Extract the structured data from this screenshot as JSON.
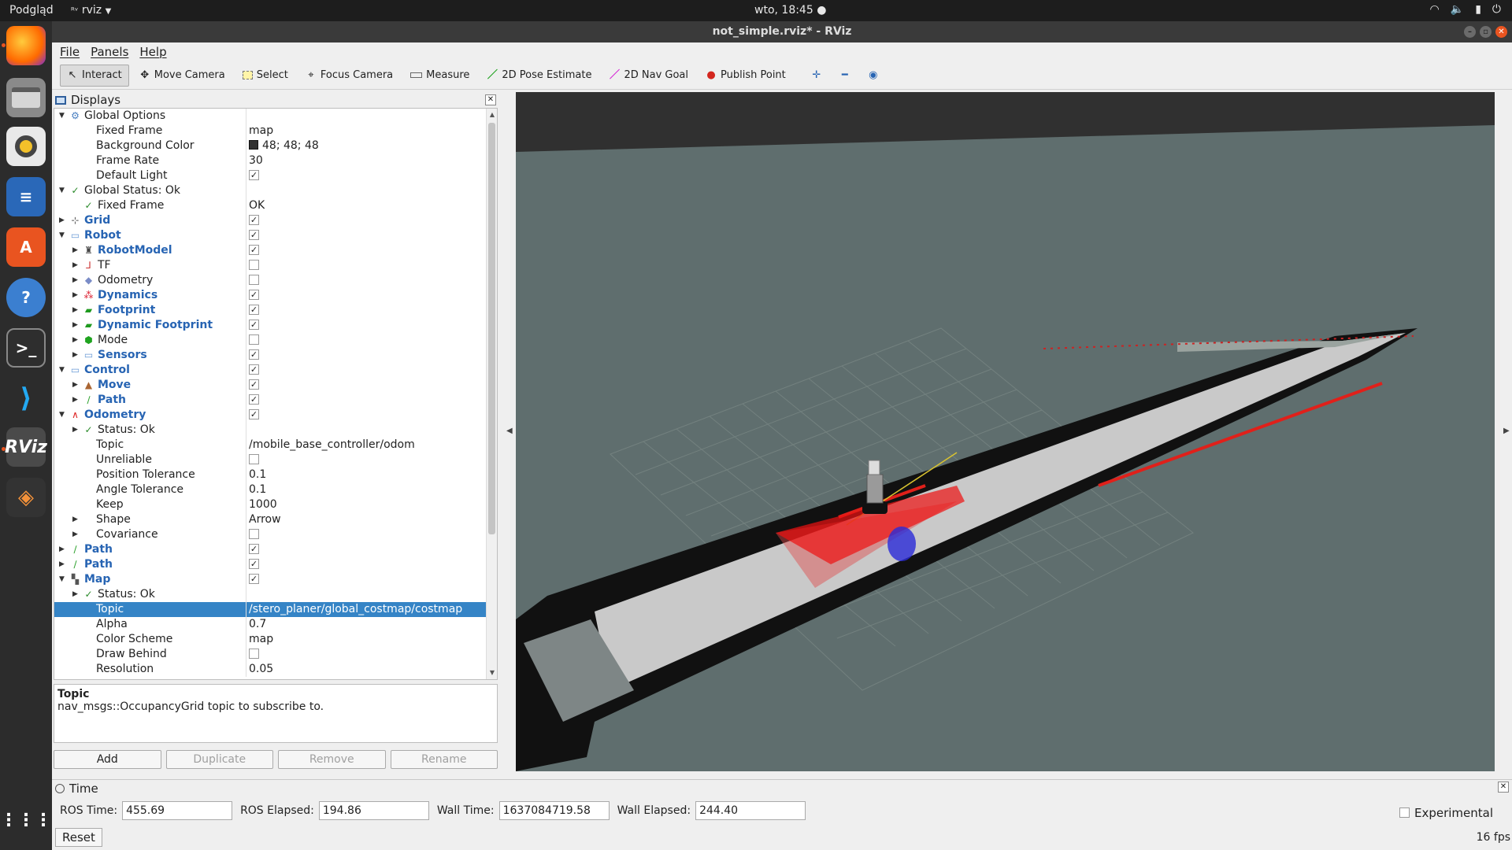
{
  "topbar": {
    "app_label": "Podgląd",
    "app_menu": "rviz",
    "clock": "wto, 18:45"
  },
  "window": {
    "title": "not_simple.rviz* - RViz"
  },
  "menu": {
    "file": "File",
    "panels": "Panels",
    "help": "Help"
  },
  "toolbar": {
    "interact": "Interact",
    "move_camera": "Move Camera",
    "select": "Select",
    "focus_camera": "Focus Camera",
    "measure": "Measure",
    "pose_estimate": "2D Pose Estimate",
    "nav_goal": "2D Nav Goal",
    "publish_point": "Publish Point"
  },
  "displays": {
    "title": "Displays",
    "rows": [
      {
        "name": "Global Options",
        "value": "",
        "type": "text"
      },
      {
        "name": "Fixed Frame",
        "value": "map",
        "type": "text"
      },
      {
        "name": "Background Color",
        "value": "48; 48; 48",
        "type": "color"
      },
      {
        "name": "Frame Rate",
        "value": "30",
        "type": "text"
      },
      {
        "name": "Default Light",
        "value": "",
        "type": "check_on"
      },
      {
        "name": "Global Status: Ok",
        "value": "",
        "type": "text"
      },
      {
        "name": "Fixed Frame",
        "value": "OK",
        "type": "text"
      },
      {
        "name": "Grid",
        "value": "",
        "type": "check_on"
      },
      {
        "name": "Robot",
        "value": "",
        "type": "check_on"
      },
      {
        "name": "RobotModel",
        "value": "",
        "type": "check_on"
      },
      {
        "name": "TF",
        "value": "",
        "type": "check_off"
      },
      {
        "name": "Odometry",
        "value": "",
        "type": "check_off"
      },
      {
        "name": "Dynamics",
        "value": "",
        "type": "check_on"
      },
      {
        "name": "Footprint",
        "value": "",
        "type": "check_on"
      },
      {
        "name": "Dynamic Footprint",
        "value": "",
        "type": "check_on"
      },
      {
        "name": "Mode",
        "value": "",
        "type": "check_off"
      },
      {
        "name": "Sensors",
        "value": "",
        "type": "check_on"
      },
      {
        "name": "Control",
        "value": "",
        "type": "check_on"
      },
      {
        "name": "Move",
        "value": "",
        "type": "check_on"
      },
      {
        "name": "Path",
        "value": "",
        "type": "check_on"
      },
      {
        "name": "Odometry",
        "value": "",
        "type": "check_on"
      },
      {
        "name": "Status: Ok",
        "value": "",
        "type": "text"
      },
      {
        "name": "Topic",
        "value": "/mobile_base_controller/odom",
        "type": "text"
      },
      {
        "name": "Unreliable",
        "value": "",
        "type": "check_off"
      },
      {
        "name": "Position Tolerance",
        "value": "0.1",
        "type": "text"
      },
      {
        "name": "Angle Tolerance",
        "value": "0.1",
        "type": "text"
      },
      {
        "name": "Keep",
        "value": "1000",
        "type": "text"
      },
      {
        "name": "Shape",
        "value": "Arrow",
        "type": "text"
      },
      {
        "name": "Covariance",
        "value": "",
        "type": "check_off"
      },
      {
        "name": "Path",
        "value": "",
        "type": "check_on"
      },
      {
        "name": "Path",
        "value": "",
        "type": "check_on"
      },
      {
        "name": "Map",
        "value": "",
        "type": "check_on"
      },
      {
        "name": "Status: Ok",
        "value": "",
        "type": "text"
      },
      {
        "name": "Topic",
        "value": "/stero_planer/global_costmap/costmap",
        "type": "text"
      },
      {
        "name": "Alpha",
        "value": "0.7",
        "type": "text"
      },
      {
        "name": "Color Scheme",
        "value": "map",
        "type": "text"
      },
      {
        "name": "Draw Behind",
        "value": "",
        "type": "check_off"
      },
      {
        "name": "Resolution",
        "value": "0.05",
        "type": "text"
      }
    ],
    "description": {
      "title": "Topic",
      "text": "nav_msgs::OccupancyGrid topic to subscribe to."
    },
    "buttons": {
      "add": "Add",
      "duplicate": "Duplicate",
      "remove": "Remove",
      "rename": "Rename"
    }
  },
  "time": {
    "title": "Time",
    "ros_time_label": "ROS Time:",
    "ros_time": "455.69",
    "ros_elapsed_label": "ROS Elapsed:",
    "ros_elapsed": "194.86",
    "wall_time_label": "Wall Time:",
    "wall_time": "1637084719.58",
    "wall_elapsed_label": "Wall Elapsed:",
    "wall_elapsed": "244.40",
    "experimental": "Experimental",
    "reset": "Reset",
    "fps": "16 fps"
  },
  "colors": {
    "accent": "#e95420",
    "selection": "#3584c6",
    "link_blue": "#2764b3",
    "view_bg": "#5f6e6e"
  }
}
